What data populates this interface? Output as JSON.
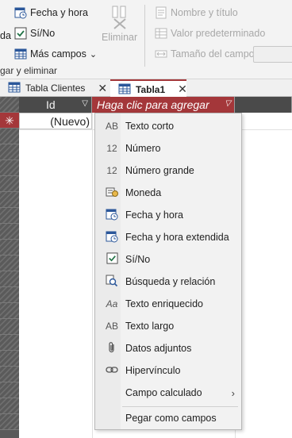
{
  "ribbon": {
    "items": [
      {
        "label": "Fecha y hora",
        "icon": "date-time-icon"
      },
      {
        "label": "Sí/No",
        "icon": "checkbox-icon"
      },
      {
        "label": "Más campos",
        "icon": "table-icon"
      },
      {
        "label": "Eliminar",
        "icon": "delete-icon"
      },
      {
        "label": "Nombre y título",
        "icon": "name-caption-icon"
      },
      {
        "label": "Valor predeterminado",
        "icon": "default-value-icon"
      },
      {
        "label": "Tamaño del campo",
        "icon": "field-size-icon"
      }
    ],
    "left_cut_label": "da",
    "group_label": "gar y eliminar",
    "more_fields_chevron": "⌄"
  },
  "tabs": [
    {
      "label": "Tabla Clientes",
      "close": "✕",
      "active": false
    },
    {
      "label": "Tabla1",
      "close": "✕",
      "active": true
    }
  ],
  "datasheet": {
    "columns": [
      {
        "label": "Id",
        "arrow": "▽"
      },
      {
        "label": "Haga clic para agregar",
        "arrow": "▽"
      }
    ],
    "new_row_marker": "✳",
    "new_row_value": "(Nuevo)"
  },
  "menu": {
    "items": [
      {
        "icon_text": "AB",
        "label": "Texto corto"
      },
      {
        "icon_text": "12",
        "label": "Número"
      },
      {
        "icon_text": "12",
        "label": "Número grande"
      },
      {
        "icon_text": "",
        "label": "Moneda"
      },
      {
        "icon_text": "",
        "label": "Fecha y hora"
      },
      {
        "icon_text": "",
        "label": "Fecha y hora extendida"
      },
      {
        "icon_text": "",
        "label": "Sí/No"
      },
      {
        "icon_text": "",
        "label": "Búsqueda y relación"
      },
      {
        "icon_text": "Aa",
        "label": "Texto enriquecido"
      },
      {
        "icon_text": "AB",
        "label": "Texto largo"
      },
      {
        "icon_text": "",
        "label": "Datos adjuntos"
      },
      {
        "icon_text": "",
        "label": "Hipervínculo"
      },
      {
        "icon_text": "",
        "label": "Campo calculado",
        "submenu": "›"
      },
      {
        "icon_text": "",
        "label": "Pegar como campos"
      }
    ]
  },
  "colors": {
    "accent": "#a4373a",
    "header_dark": "#4a4a4a",
    "ribbon_bg": "#f3f3f3"
  }
}
